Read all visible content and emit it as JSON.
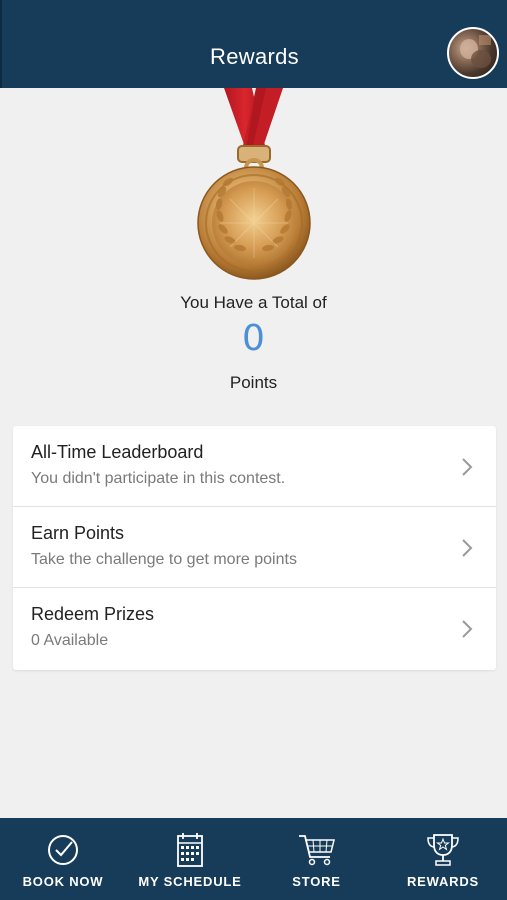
{
  "header": {
    "title": "Rewards",
    "avatar_icon": "user-avatar"
  },
  "summary": {
    "label": "You Have a Total of",
    "points": "0",
    "unit": "Points",
    "points_color": "#4a8fd8",
    "badge_icon": "gold-medal-icon"
  },
  "menu": {
    "items": [
      {
        "title": "All-Time Leaderboard",
        "subtitle": "You didn't participate in this contest."
      },
      {
        "title": "Earn Points",
        "subtitle": "Take the challenge to get more points"
      },
      {
        "title": "Redeem Prizes",
        "subtitle": "0 Available"
      }
    ],
    "chevron_icon": "chevron-right-icon"
  },
  "tabs": [
    {
      "label": "BOOK NOW",
      "icon": "check-circle-icon"
    },
    {
      "label": "MY SCHEDULE",
      "icon": "calendar-icon"
    },
    {
      "label": "STORE",
      "icon": "cart-icon"
    },
    {
      "label": "REWARDS",
      "icon": "trophy-icon"
    }
  ],
  "colors": {
    "header_bg": "#173c59",
    "tabbar_bg": "#173c59",
    "page_bg": "#f0f0f0"
  }
}
